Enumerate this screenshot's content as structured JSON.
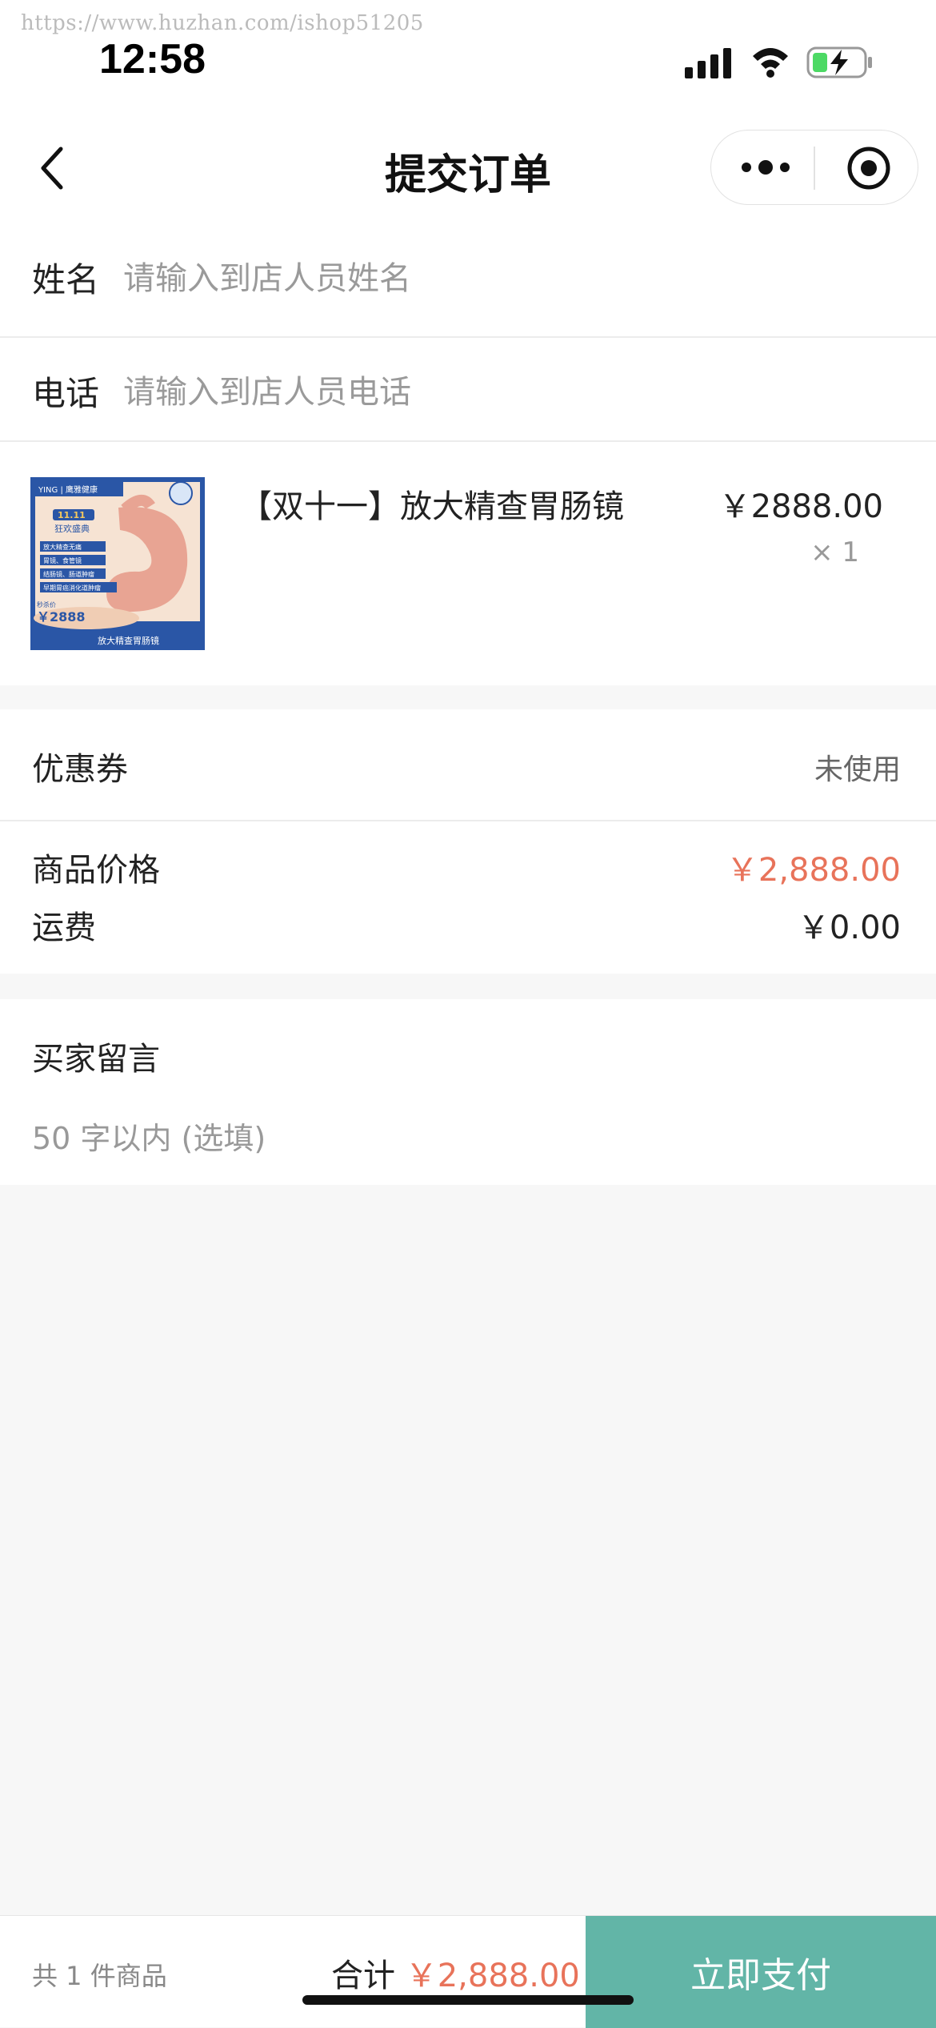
{
  "watermark": "https://www.huzhan.com/ishop51205",
  "status": {
    "time": "12:58"
  },
  "nav": {
    "title": "提交订单"
  },
  "form": {
    "name_label": "姓名",
    "name_placeholder": "请输入到店人员姓名",
    "phone_label": "电话",
    "phone_placeholder": "请输入到店人员电话"
  },
  "product": {
    "name": "【双十一】放大精查胃肠镜",
    "price": "￥2888.00",
    "qty": "× 1",
    "image": {
      "brand": "YING | 鹰雅健康",
      "badge": "11.11",
      "sub": "狂欢盛典",
      "features": [
        "放大精查无痛",
        "胃镜、食管镜",
        "结肠镜、肠道肿瘤",
        "早期胃癌消化道肿瘤"
      ],
      "price_tag": "￥2888",
      "price_label": "秒杀价",
      "footer": "放大精查胃肠镜"
    }
  },
  "fees": {
    "coupon_label": "优惠券",
    "coupon_status": "未使用",
    "goods_price_label": "商品价格",
    "goods_price": "￥2,888.00",
    "shipping_label": "运费",
    "shipping": "￥0.00"
  },
  "message": {
    "title": "买家留言",
    "placeholder": "50 字以内 (选填)"
  },
  "bottom": {
    "count": "共 1 件商品",
    "total_label": "合计",
    "total_value": "￥2,888.00",
    "pay_label": "立即支付"
  },
  "colors": {
    "accent": "#62b5a7",
    "price_red": "#e8735a"
  }
}
